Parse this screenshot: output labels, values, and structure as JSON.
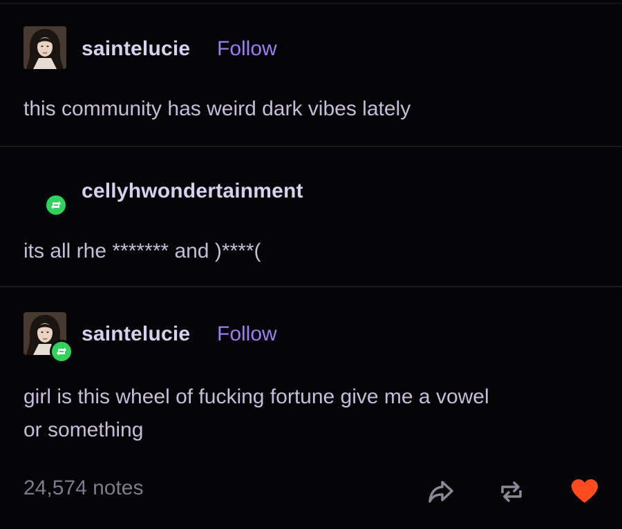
{
  "posts": [
    {
      "username": "saintelucie",
      "follow_label": "Follow",
      "text": "this community has weird dark vibes lately"
    },
    {
      "username": "cellyhwondertainment",
      "text": "its all rhe ******* and )****("
    },
    {
      "username": "saintelucie",
      "follow_label": "Follow",
      "text_lines": [
        "girl is this wheel of fucking fortune give me a vowel",
        "or something"
      ]
    }
  ],
  "footer": {
    "notes": "24,574 notes",
    "icons": [
      "share-icon",
      "reblog-icon",
      "like-heart-icon"
    ]
  },
  "colors": {
    "background": "#050406",
    "username": "#d8d0ef",
    "follow": "#9a7ff2",
    "text": "#c5bddb",
    "reblog_green": "#2fd35b",
    "heart": "#ff4a1f"
  }
}
